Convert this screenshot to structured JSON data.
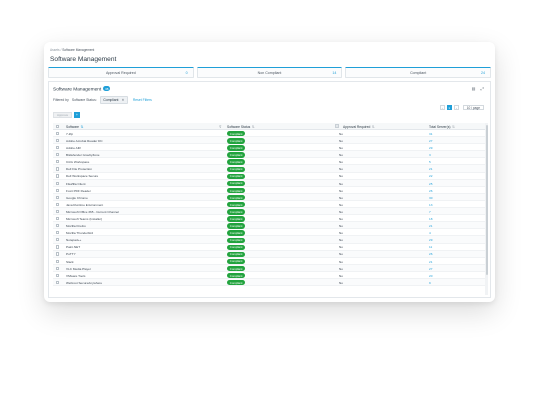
{
  "breadcrumb": {
    "root": "Assets",
    "sep": " / ",
    "current": "Software Management"
  },
  "page_title": "Software Management",
  "summary": [
    {
      "label": "Approval Required",
      "value": "0"
    },
    {
      "label": "Non Compliant",
      "value": "14"
    },
    {
      "label": "Compliant",
      "value": "24"
    }
  ],
  "panel": {
    "title": "Software Management",
    "count": "38",
    "filtered_by_label": "Filtered by",
    "filter_field": "Software Status:",
    "filter_value": "Compliant",
    "reset_label": "Reset Filters",
    "approve_label": "Approve",
    "add_label": "+"
  },
  "pager": {
    "prev": "‹",
    "page": "1",
    "next": "›",
    "per_page": "10 / page"
  },
  "columns": {
    "software": "Software",
    "status": "Software Status",
    "approval": "Approval Required",
    "servers": "Total Server(s)"
  },
  "rows": [
    {
      "name": "7-Zip",
      "status": "Compliant",
      "approval": "No",
      "servers": "31"
    },
    {
      "name": "Adobe Acrobat Reader DC",
      "status": "Compliant",
      "approval": "No",
      "servers": "27"
    },
    {
      "name": "Adobe AIR",
      "status": "Compliant",
      "approval": "No",
      "servers": "29"
    },
    {
      "name": "Bitdefender GravityZone",
      "status": "Compliant",
      "approval": "No",
      "servers": "3"
    },
    {
      "name": "Citrix Workspace",
      "status": "Compliant",
      "approval": "No",
      "servers": "5"
    },
    {
      "name": "Dell File Protection",
      "status": "Compliant",
      "approval": "No",
      "servers": "21"
    },
    {
      "name": "Dell Workspace Secure",
      "status": "Compliant",
      "approval": "No",
      "servers": "22"
    },
    {
      "name": "FileZilla Client",
      "status": "Compliant",
      "approval": "No",
      "servers": "25"
    },
    {
      "name": "Foxit PDF Reader",
      "status": "Compliant",
      "approval": "No",
      "servers": "26"
    },
    {
      "name": "Google Chrome",
      "status": "Compliant",
      "approval": "No",
      "servers": "30"
    },
    {
      "name": "Java Runtime Environment",
      "status": "Compliant",
      "approval": "No",
      "servers": "13"
    },
    {
      "name": "Microsoft Office 365 - Current Channel",
      "status": "Compliant",
      "approval": "No",
      "servers": "7"
    },
    {
      "name": "Microsoft Teams (Installer)",
      "status": "Compliant",
      "approval": "No",
      "servers": "18"
    },
    {
      "name": "Mozilla Firefox",
      "status": "Compliant",
      "approval": "No",
      "servers": "21"
    },
    {
      "name": "Mozilla Thunderbird",
      "status": "Compliant",
      "approval": "No",
      "servers": "4"
    },
    {
      "name": "Notepad++",
      "status": "Compliant",
      "approval": "No",
      "servers": "29"
    },
    {
      "name": "Paint.NET",
      "status": "Compliant",
      "approval": "No",
      "servers": "11"
    },
    {
      "name": "PuTTY",
      "status": "Compliant",
      "approval": "No",
      "servers": "26"
    },
    {
      "name": "Slack",
      "status": "Compliant",
      "approval": "No",
      "servers": "21"
    },
    {
      "name": "VLC Media Player",
      "status": "Compliant",
      "approval": "No",
      "servers": "27"
    },
    {
      "name": "VMware Tools",
      "status": "Compliant",
      "approval": "No",
      "servers": "20"
    },
    {
      "name": "Webroot SecureAnywhere",
      "status": "Compliant",
      "approval": "No",
      "servers": "9"
    }
  ]
}
